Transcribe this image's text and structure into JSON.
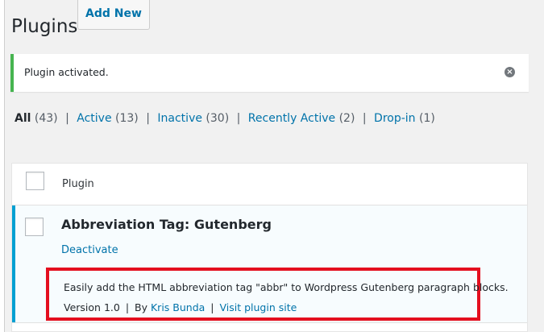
{
  "page": {
    "title": "Plugins",
    "add_new_label": "Add New"
  },
  "notice": {
    "prefix": "Plugin ",
    "strong": "activated.",
    "dismiss_icon": "×"
  },
  "filters": {
    "items": [
      {
        "label": "All",
        "count": "(43)"
      },
      {
        "label": "Active",
        "count": "(13)"
      },
      {
        "label": "Inactive",
        "count": "(30)"
      },
      {
        "label": "Recently Active",
        "count": "(2)"
      },
      {
        "label": "Drop-in",
        "count": "(1)"
      }
    ],
    "separator": "|"
  },
  "table": {
    "column_plugin": "Plugin",
    "rows": [
      {
        "name": "Abbreviation Tag: Gutenberg",
        "action": "Deactivate",
        "description": "Easily add the HTML abbreviation tag \"abbr\" to Wordpress Gutenberg paragraph blocks.",
        "version": "Version 1.0",
        "by_label": "By",
        "author": "Kris Bunda",
        "separator": "|",
        "site_link": "Visit plugin site"
      }
    ]
  },
  "colors": {
    "link": "#0073aa",
    "success": "#46b450",
    "active_row": "#00a0d2",
    "highlight_box": "#e40f1f"
  }
}
